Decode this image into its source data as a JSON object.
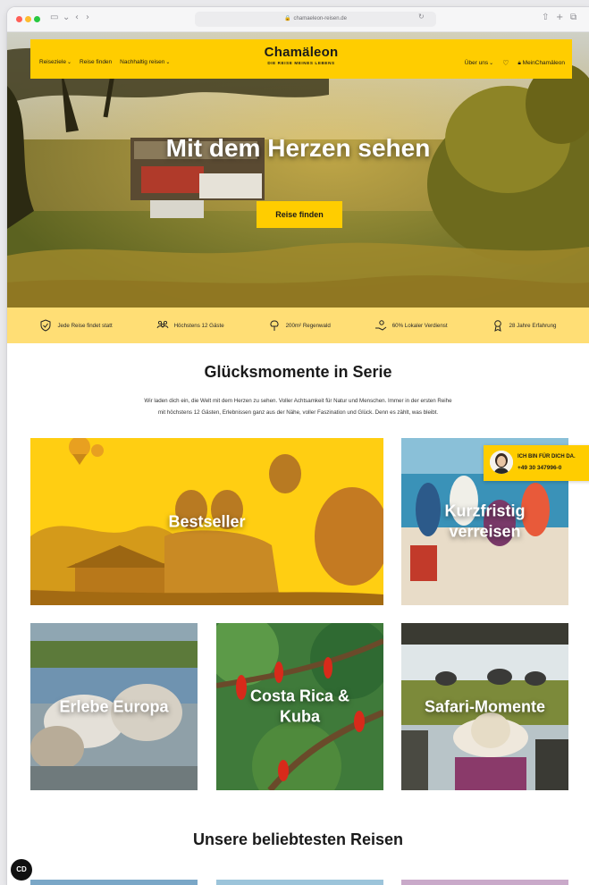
{
  "browser": {
    "url": "chamaeleon-reisen.de"
  },
  "nav": {
    "items": [
      {
        "label": "Reiseziele",
        "dropdown": true
      },
      {
        "label": "Reise finden",
        "dropdown": false
      },
      {
        "label": "Nachhaltig reisen",
        "dropdown": true
      }
    ],
    "logo_name": "Chamäleon",
    "logo_tagline": "DIE REISE MEINES LEBENS",
    "about_label": "Über uns",
    "account_label": "MeinChamäleon"
  },
  "hero": {
    "title": "Mit dem Herzen sehen",
    "button_label": "Reise finden"
  },
  "features": [
    {
      "icon": "shield-check-icon",
      "label": "Jede Reise findet statt"
    },
    {
      "icon": "group-icon",
      "label": "Höchstens 12 Gäste"
    },
    {
      "icon": "tree-icon",
      "label": "200m² Regenwald"
    },
    {
      "icon": "hand-money-icon",
      "label": "60% Lokaler Verdienst"
    },
    {
      "icon": "award-icon",
      "label": "28 Jahre Erfahrung"
    }
  ],
  "intro": {
    "title": "Glücksmomente in Serie",
    "text_line1": "Wir laden dich ein, die Welt mit dem Herzen zu sehen. Voller Achtsamkeit für Natur und Menschen. Immer in der ersten Reihe",
    "text_line2": "mit höchstens 12 Gästen, Erlebnissen ganz aus der Nähe, voller Faszination und Glück. Denn es zählt, was bleibt."
  },
  "tiles": {
    "bestseller": "Bestseller",
    "kurzfristig_1": "Kurzfristig",
    "kurzfristig_2": "verreisen",
    "europa": "Erlebe Europa",
    "costa_1": "Costa Rica &",
    "costa_2": "Kuba",
    "safari": "Safari-Momente"
  },
  "contact": {
    "line1": "ICH BIN FÜR DICH DA.",
    "phone": "+49 30 347996-0"
  },
  "section2": {
    "title": "Unsere beliebtesten Reisen"
  },
  "cookie_label": "CD",
  "colors": {
    "brand_yellow": "#ffcd00",
    "feature_bar": "#ffde75"
  }
}
